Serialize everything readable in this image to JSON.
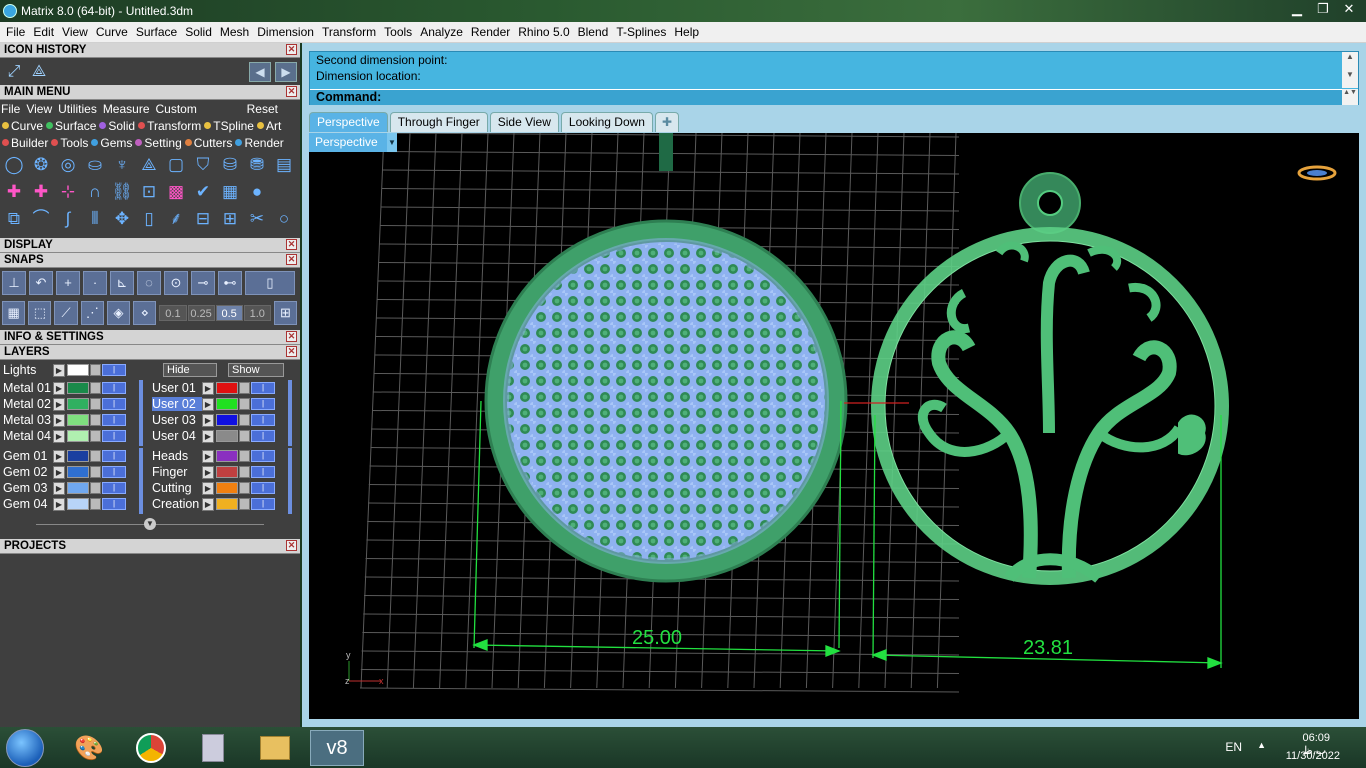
{
  "window": {
    "title": "Matrix 8.0 (64-bit) - Untitled.3dm",
    "min": "▁",
    "max": "❐",
    "close": "✕"
  },
  "menubar": [
    "File",
    "Edit",
    "View",
    "Curve",
    "Surface",
    "Solid",
    "Mesh",
    "Dimension",
    "Transform",
    "Tools",
    "Analyze",
    "Render",
    "Rhino 5.0",
    "Blend",
    "T-Splines",
    "Help"
  ],
  "panels": {
    "icon_history": "ICON HISTORY",
    "main_menu": "MAIN MENU",
    "display": "DISPLAY",
    "snaps": "SNAPS",
    "info_settings": "INFO & SETTINGS",
    "layers": "LAYERS",
    "projects": "PROJECTS"
  },
  "main_menu": {
    "row1": [
      "File",
      "View",
      "Utilities",
      "Measure",
      "Custom"
    ],
    "reset": "Reset",
    "row2": [
      {
        "label": "Curve",
        "color": "#e8c040"
      },
      {
        "label": "Surface",
        "color": "#40c060"
      },
      {
        "label": "Solid",
        "color": "#a060e0"
      },
      {
        "label": "Transform",
        "color": "#e05050"
      },
      {
        "label": "TSpline",
        "color": "#e8c040"
      },
      {
        "label": "Art",
        "color": "#e8c040"
      }
    ],
    "row3": [
      {
        "label": "Builder",
        "color": "#e05050"
      },
      {
        "label": "Tools",
        "color": "#e05050"
      },
      {
        "label": "Gems",
        "color": "#40a0e0"
      },
      {
        "label": "Setting",
        "color": "#c060c0"
      },
      {
        "label": "Cutters",
        "color": "#e08040"
      },
      {
        "label": "Render",
        "color": "#40a0e0"
      }
    ]
  },
  "snaps": {
    "values": [
      "0.1",
      "0.25",
      "0.5",
      "1.0"
    ],
    "active": "0.5"
  },
  "layers": {
    "lights": "Lights",
    "hide": "Hide",
    "show": "Show",
    "left": [
      {
        "name": "Metal 01",
        "color": "#1a8a4a"
      },
      {
        "name": "Metal 02",
        "color": "#30b060"
      },
      {
        "name": "Metal 03",
        "color": "#7fe07f"
      },
      {
        "name": "Metal 04",
        "color": "#b0f0b0"
      },
      {
        "name": "Gem 01",
        "color": "#1a3fa0"
      },
      {
        "name": "Gem 02",
        "color": "#2f6fd0"
      },
      {
        "name": "Gem 03",
        "color": "#70a8f0"
      },
      {
        "name": "Gem 04",
        "color": "#b8d4f8"
      }
    ],
    "right": [
      {
        "name": "User 01",
        "color": "#e01010"
      },
      {
        "name": "User 02",
        "color": "#20e020"
      },
      {
        "name": "User 03",
        "color": "#1010e0"
      },
      {
        "name": "User 04",
        "color": "#8a8a8a"
      },
      {
        "name": "Heads",
        "color": "#8a30c0"
      },
      {
        "name": "Finger",
        "color": "#c04040"
      },
      {
        "name": "Cutting",
        "color": "#f08010"
      },
      {
        "name": "Creation",
        "color": "#f0b020"
      }
    ],
    "selected": "User 02"
  },
  "command": {
    "line1": "Second dimension point:",
    "line2": "Dimension location:",
    "prompt": "Command:"
  },
  "tabs": [
    "Perspective",
    "Through Finger",
    "Side View",
    "Looking Down"
  ],
  "active_tab": "Perspective",
  "viewport": {
    "name": "Perspective",
    "dim1": "25.00",
    "dim2": "23.81",
    "axis_y": "y",
    "axis_z": "z",
    "axis_x": "x"
  },
  "taskbar": {
    "lang": "EN",
    "time": "06:09 ب.ظ",
    "date": "11/30/2022",
    "active_app": "v8"
  },
  "colors": {
    "accent": "#46b5e0",
    "panel_bg": "#3f3f3f",
    "model_green": "#3fa06a",
    "gem_blue": "#8fb2f0",
    "dim_green": "#22e040"
  }
}
